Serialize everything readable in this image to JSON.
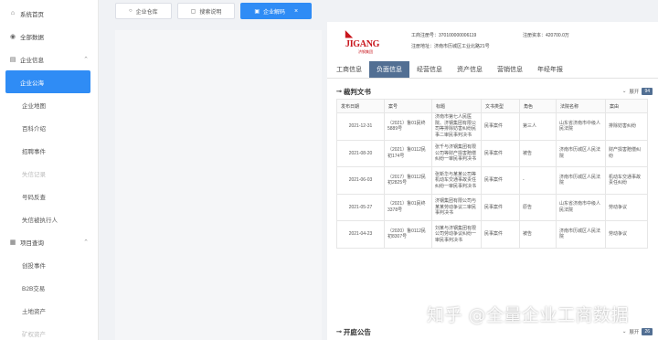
{
  "sidebar": {
    "items": [
      {
        "label": "系统首页",
        "icon": "home-icon",
        "type": "top"
      },
      {
        "label": "全部数据",
        "icon": "database-icon",
        "type": "top"
      },
      {
        "label": "企业信息",
        "icon": "building-icon",
        "type": "group",
        "arrow": "⌃"
      },
      {
        "label": "企业公海",
        "type": "sub",
        "active": true
      },
      {
        "label": "企业地图",
        "type": "sub"
      },
      {
        "label": "百科介绍",
        "type": "sub"
      },
      {
        "label": "招聘事件",
        "type": "sub"
      },
      {
        "label": "失信记录",
        "type": "sub",
        "disabled": true
      },
      {
        "label": "号码反查",
        "type": "sub"
      },
      {
        "label": "失信被执行人",
        "type": "sub"
      },
      {
        "label": "项目查询",
        "icon": "project-icon",
        "type": "group",
        "arrow": "⌃"
      },
      {
        "label": "创投事件",
        "type": "sub"
      },
      {
        "label": "B2B交易",
        "type": "sub"
      },
      {
        "label": "土地资产",
        "type": "sub"
      },
      {
        "label": "矿权资产",
        "type": "sub",
        "disabled": true
      }
    ]
  },
  "toolbar": {
    "btn1": "企业仓库",
    "btn2": "搜索说明",
    "btn3": "企业解码",
    "close": "×"
  },
  "company": {
    "logo_word": "JIGANG",
    "logo_sub": "济钢集团",
    "reg_no": "工商注册号：370100000006119",
    "address": "注册地址：济南市历城区工业北路21号",
    "capital": "注册资本：420700.0万"
  },
  "tabs": [
    "工商信息",
    "负面信息",
    "经营信息",
    "资产信息",
    "营销信息",
    "年经年报"
  ],
  "sections": {
    "judgment": {
      "title": "裁判文书",
      "expand": "展开",
      "count": "94"
    },
    "court": {
      "title": "开庭公告",
      "expand": "展开",
      "count": "26"
    }
  },
  "table": {
    "headers": [
      "发布日期",
      "案号",
      "标题",
      "文书类型",
      "角色",
      "法院名称",
      "案由"
    ],
    "rows": [
      [
        "2021-12-31",
        "（2021）鲁01民终5889号",
        "济南市第七人民医院、济钢集团有限公司等排除妨害纠纷民事二审民事判决书",
        "民事案件",
        "第三人",
        "山东省济南市中级人民法院",
        "排除妨害纠纷"
      ],
      [
        "2021-08-20",
        "（2021）鲁0112民初174号",
        "张千与济钢集团有限公司等财产损害赔偿纠纷一审民事判决书",
        "民事案件",
        "被告",
        "济南市历城区人民法院",
        "财产损害赔偿纠纷"
      ],
      [
        "2021-06-03",
        "（2017）鲁0112民初2825号",
        "张新华与某某公司等机动车交通事故责任纠纷一审民事判决书",
        "民事案件",
        "-",
        "济南市历城区人民法院",
        "机动车交通事故责任纠纷"
      ],
      [
        "2021-05-27",
        "（2021）鲁01民终3378号",
        "济钢集团有限公司与某某劳动争议二审民事判决书",
        "民事案件",
        "原告",
        "山东省济南市中级人民法院",
        "劳动争议"
      ],
      [
        "2021-04-23",
        "（2020）鲁0112民初8307号",
        "刘某与济钢集团有限公司劳动争议纠纷一审民事判决书",
        "民事案件",
        "被告",
        "济南市历城区人民法院",
        "劳动争议"
      ]
    ]
  },
  "watermark": "知乎 @全量企业工商数据",
  "colors": {
    "accent": "#2f8cf5",
    "tab_active": "#526f93",
    "logo": "#c8161d"
  }
}
